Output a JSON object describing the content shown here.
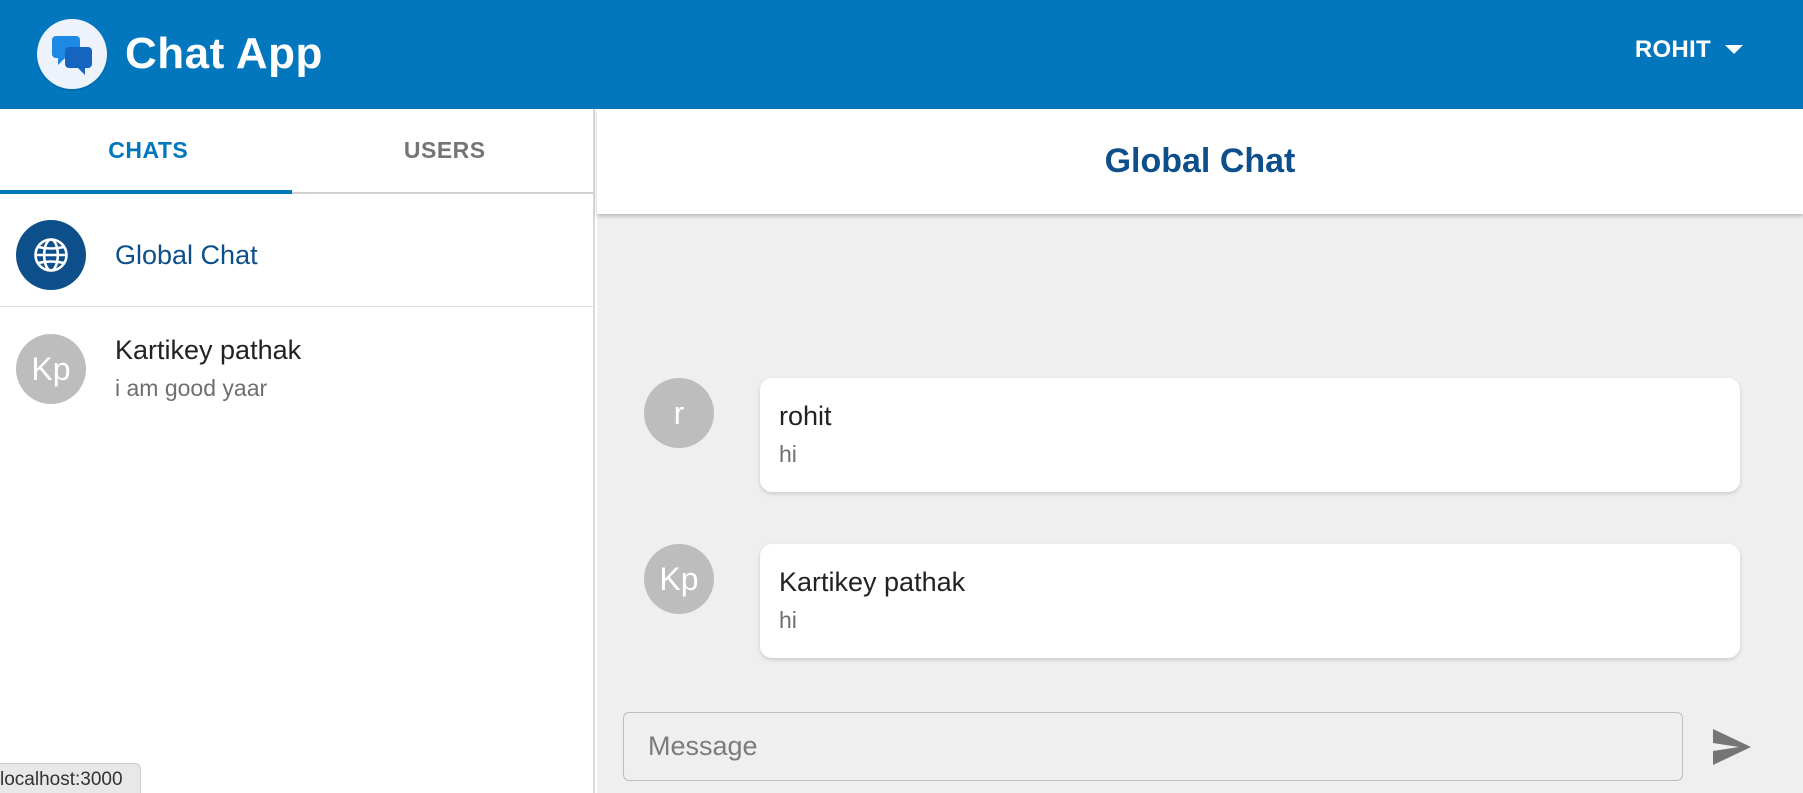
{
  "appbar": {
    "title": "Chat App",
    "user_name": "ROHIT",
    "logo_icon": "chat-bubbles-icon",
    "menu_icon": "caret-down-icon",
    "color": "#0277BD"
  },
  "sidebar": {
    "tabs": [
      {
        "label": "CHATS",
        "active": true
      },
      {
        "label": "USERS",
        "active": false
      }
    ],
    "chats": [
      {
        "name": "Global Chat",
        "preview": "",
        "avatar_icon": "globe-icon",
        "avatar_text": ""
      },
      {
        "name": "Kartikey pathak",
        "preview": "i am good yaar",
        "avatar_text": "Kp"
      }
    ],
    "status_url": "localhost:3000"
  },
  "main": {
    "title": "Global Chat",
    "messages": [
      {
        "avatar_text": "r",
        "author": "rohit",
        "text": "hi"
      },
      {
        "avatar_text": "Kp",
        "author": "Kartikey pathak",
        "text": "hi"
      }
    ],
    "composer": {
      "placeholder": "Message",
      "value": ""
    },
    "send_icon": "send-icon"
  },
  "colors": {
    "primary": "#0277BD",
    "heading": "#0d4f8b",
    "avatar_grey": "#bdbdbd",
    "panel_bg": "#efefef"
  }
}
